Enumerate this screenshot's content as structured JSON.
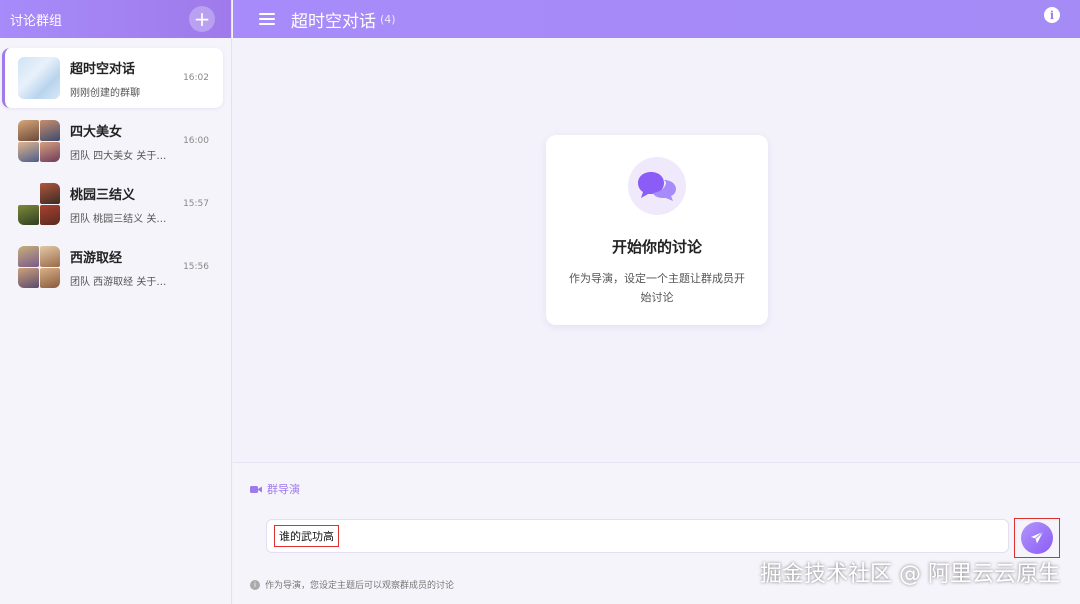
{
  "sidebar": {
    "title": "讨论群组",
    "add_symbol": "+",
    "items": [
      {
        "name": "超时空对话",
        "subtitle": "刚刚创建的群聊",
        "time": "16:02",
        "active": true
      },
      {
        "name": "四大美女",
        "subtitle": "团队 四大美女 关于…",
        "time": "16:00",
        "active": false
      },
      {
        "name": "桃园三结义",
        "subtitle": "团队 桃园三结义 关…",
        "time": "15:57",
        "active": false
      },
      {
        "name": "西游取经",
        "subtitle": "团队 西游取经 关于…",
        "time": "15:56",
        "active": false
      }
    ]
  },
  "header": {
    "title": "超时空对话",
    "member_count": "(4)",
    "info_symbol": "i"
  },
  "empty_state": {
    "title": "开始你的讨论",
    "description": "作为导演，设定一个主题让群成员开始讨论"
  },
  "composer": {
    "role_label": "群导演",
    "input_value": "谁的武功高",
    "hint": "作为导演，您设定主题后可以观察群成员的讨论",
    "hint_symbol": "i"
  },
  "watermark": "掘金技术社区 @ 阿里云云原生",
  "colors": {
    "accent": "#9f7aea",
    "header_bg": "#a78bfa",
    "highlight_border": "#e0302e"
  }
}
